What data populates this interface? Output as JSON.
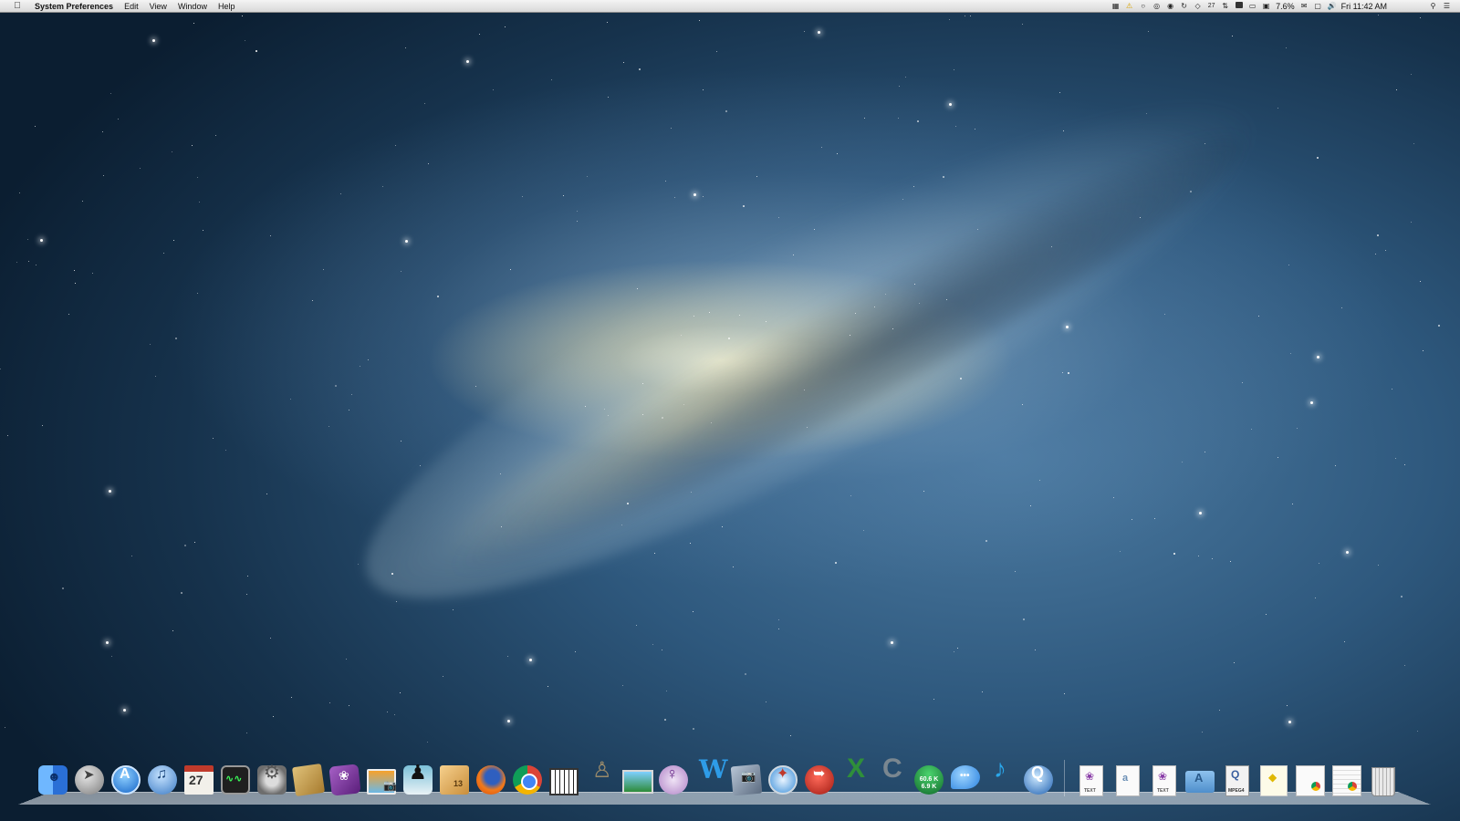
{
  "menubar": {
    "apple_icon": "apple-icon",
    "app_name": "System Preferences",
    "menus": [
      "Edit",
      "View",
      "Window",
      "Help"
    ],
    "status": {
      "cpu_percent": "7.6%",
      "clock": "Fri 11:42 AM",
      "icons": [
        "folder-icon",
        "warning-icon",
        "lock-icon",
        "headphones-icon",
        "globe-icon",
        "sync-icon",
        "dropbox-icon",
        "calendar-icon",
        "activity-icon",
        "battery-icon",
        "display-icon",
        "airplay-icon",
        "mail-icon",
        "volume-icon",
        "spotlight-icon",
        "list-icon"
      ],
      "calendar_day": "27"
    }
  },
  "desktop": {
    "wallpaper": "galaxy",
    "accent_colors": {
      "sky_dark": "#0b1e31",
      "sky_mid": "#2e587d",
      "galaxy_core": "#fff6cd"
    }
  },
  "dock": {
    "apps": [
      {
        "name": "finder-icon",
        "label": "Finder"
      },
      {
        "name": "launchpad-icon",
        "label": "Launchpad"
      },
      {
        "name": "app-store-icon",
        "label": "App Store"
      },
      {
        "name": "itunes-icon",
        "label": "iTunes"
      },
      {
        "name": "calendar-icon",
        "label": "Calendar",
        "text": "27"
      },
      {
        "name": "activity-monitor-icon",
        "label": "Activity Monitor"
      },
      {
        "name": "system-preferences-icon",
        "label": "System Preferences"
      },
      {
        "name": "textedit-icon",
        "label": "TextEdit"
      },
      {
        "name": "purple-app-icon",
        "label": "App"
      },
      {
        "name": "iphoto-icon",
        "label": "iPhoto"
      },
      {
        "name": "spy-app-icon",
        "label": "App"
      },
      {
        "name": "box-app-icon",
        "label": "App",
        "text": "13"
      },
      {
        "name": "firefox-icon",
        "label": "Firefox"
      },
      {
        "name": "chrome-icon",
        "label": "Google Chrome"
      },
      {
        "name": "piano-icon",
        "label": "Piano"
      },
      {
        "name": "automator-icon",
        "label": "Automator"
      },
      {
        "name": "preview-icon",
        "label": "Preview"
      },
      {
        "name": "female-symbol-icon",
        "label": "App"
      },
      {
        "name": "word-icon",
        "label": "Word",
        "text": "W"
      },
      {
        "name": "image-capture-icon",
        "label": "Image Capture"
      },
      {
        "name": "safari-icon",
        "label": "Safari"
      },
      {
        "name": "red-app-icon",
        "label": "App"
      },
      {
        "name": "excel-icon",
        "label": "Excel",
        "text": "X"
      },
      {
        "name": "c-app-icon",
        "label": "App",
        "text": "C"
      },
      {
        "name": "network-monitor-icon",
        "label": "Network Monitor",
        "text_up": "60.6 K",
        "text_down": "6.9 K"
      },
      {
        "name": "messages-icon",
        "label": "Messages"
      },
      {
        "name": "music-note-icon",
        "label": "Music"
      },
      {
        "name": "quicktime-icon",
        "label": "QuickTime"
      }
    ],
    "docs": [
      {
        "name": "text-document-icon",
        "label": "TEXT"
      },
      {
        "name": "blank-document-icon",
        "label": ""
      },
      {
        "name": "text-document-icon-2",
        "label": "TEXT"
      },
      {
        "name": "applications-folder-icon",
        "label": ""
      },
      {
        "name": "mpeg-document-icon",
        "label": "MPEG4"
      },
      {
        "name": "note-document-icon",
        "label": ""
      },
      {
        "name": "chrome-document-icon",
        "label": ""
      },
      {
        "name": "chrome-document-icon-2",
        "label": ""
      },
      {
        "name": "trash-icon",
        "label": "Trash"
      }
    ]
  }
}
